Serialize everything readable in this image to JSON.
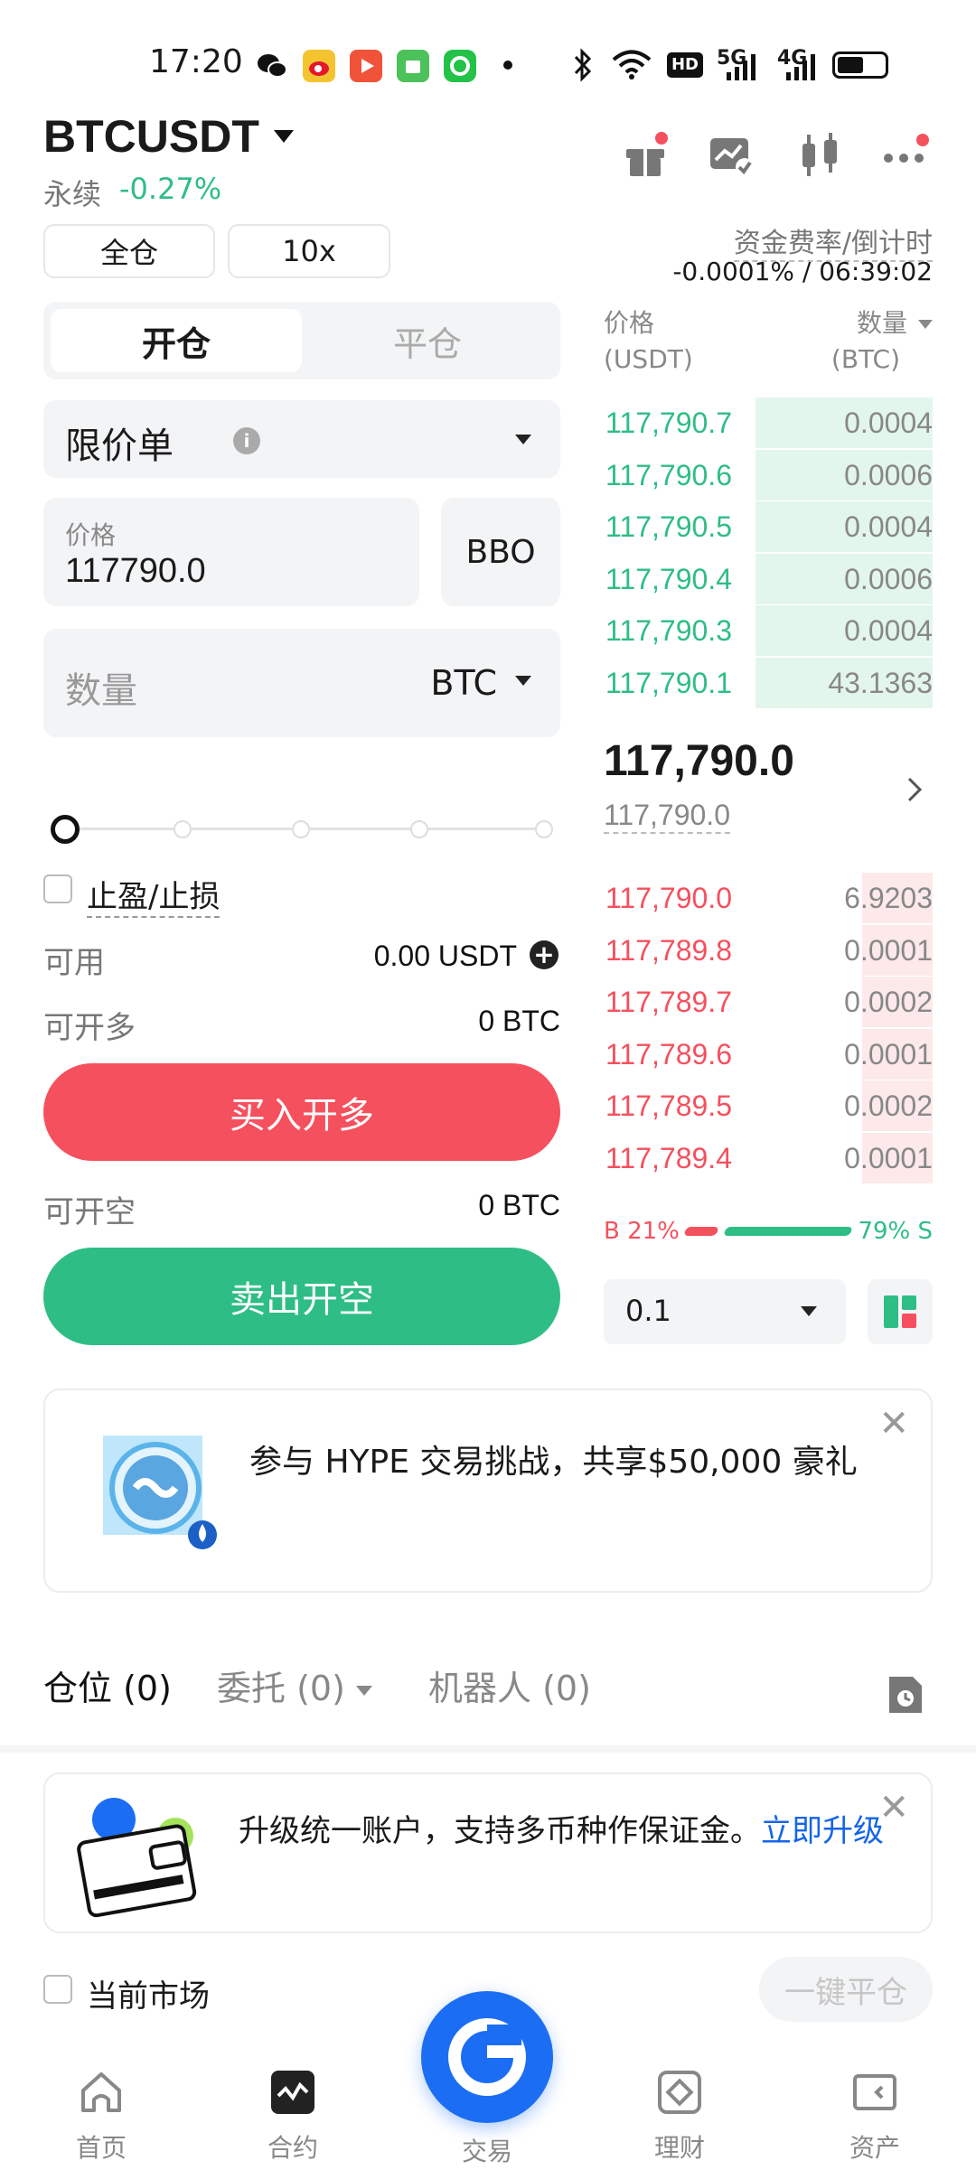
{
  "status_bar": {
    "time": "17:20",
    "network": "5G",
    "network2": "4G"
  },
  "header": {
    "symbol": "BTCUSDT",
    "contract_type": "永续",
    "change": "-0.27%",
    "margin_mode": "全仓",
    "leverage": "10x",
    "funding_label": "资金费率/倒计时",
    "funding_value": "-0.0001% / 06:39:02"
  },
  "trade": {
    "tabs": [
      "开仓",
      "平仓"
    ],
    "order_type": "限价单",
    "price_label": "价格",
    "price_value": "117790.0",
    "bbo_label": "BBO",
    "qty_label": "数量",
    "qty_unit": "BTC",
    "slider_percent": 0,
    "tpsl_label": "止盈/止损",
    "available_label": "可用",
    "available_value": "0.00 USDT",
    "long_label": "可开多",
    "long_value": "0 BTC",
    "buy_button": "买入开多",
    "short_label": "可开空",
    "short_value": "0 BTC",
    "sell_button": "卖出开空"
  },
  "orderbook": {
    "price_header": "价格",
    "price_unit": "(USDT)",
    "qty_header": "数量",
    "qty_unit": "(BTC)",
    "asks": [
      {
        "price": "117,790.7",
        "qty": "0.0004"
      },
      {
        "price": "117,790.6",
        "qty": "0.0006"
      },
      {
        "price": "117,790.5",
        "qty": "0.0004"
      },
      {
        "price": "117,790.4",
        "qty": "0.0006"
      },
      {
        "price": "117,790.3",
        "qty": "0.0004"
      },
      {
        "price": "117,790.1",
        "qty": "43.1363"
      }
    ],
    "last_price": "117,790.0",
    "mark_price": "117,790.0",
    "bids": [
      {
        "price": "117,790.0",
        "qty": "6.9203"
      },
      {
        "price": "117,789.8",
        "qty": "0.0001"
      },
      {
        "price": "117,789.7",
        "qty": "0.0002"
      },
      {
        "price": "117,789.6",
        "qty": "0.0001"
      },
      {
        "price": "117,789.5",
        "qty": "0.0002"
      },
      {
        "price": "117,789.4",
        "qty": "0.0001"
      }
    ],
    "buy_ratio": "B 21%",
    "sell_ratio": "79% S",
    "buy_ratio_value": 21,
    "precision": "0.1",
    "colors": {
      "ask": "#2ebd85",
      "bid": "#f5505e",
      "ask_bg": "#e3f6ec",
      "bid_bg": "#fde9ea"
    }
  },
  "promo": {
    "text": "参与 HYPE 交易挑战，共享$50,000 豪礼"
  },
  "positions": {
    "tab_positions": "仓位 (0)",
    "tab_orders": "委托 (0)",
    "tab_bots": "机器人 (0)"
  },
  "upgrade": {
    "text": "升级统一账户，支持多币种作保证金。",
    "link": "立即升级"
  },
  "filter": {
    "current_market": "当前市场",
    "close_all": "一键平仓"
  },
  "nav": {
    "home": "首页",
    "futures": "合约",
    "trade": "交易",
    "earn": "理财",
    "assets": "资产"
  }
}
